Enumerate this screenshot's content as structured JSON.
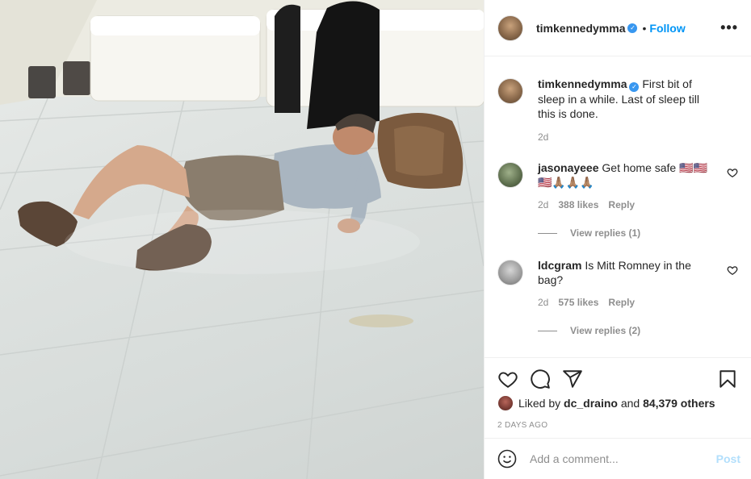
{
  "header": {
    "username": "timkennedymma",
    "separator": "•",
    "follow_label": "Follow",
    "more_label": "•••"
  },
  "caption": {
    "username": "timkennedymma",
    "text": "First bit of sleep in a while. Last of sleep till this is done.",
    "time": "2d"
  },
  "comments": [
    {
      "username": "jasonayeee",
      "text": "Get home safe 🇺🇸🇺🇸🇺🇸🙏🏽🙏🏽🙏🏽",
      "time": "2d",
      "likes": "388 likes",
      "reply_label": "Reply",
      "view_replies": "View replies (1)"
    },
    {
      "username": "ldcgram",
      "text": "Is Mitt Romney in the bag?",
      "time": "2d",
      "likes": "575 likes",
      "reply_label": "Reply",
      "view_replies": "View replies (2)"
    }
  ],
  "likes": {
    "prefix": "Liked by",
    "first_liker": "dc_draino",
    "middle": "and",
    "others": "84,379 others"
  },
  "posted_ago": "2 DAYS AGO",
  "add_comment": {
    "placeholder": "Add a comment...",
    "post_label": "Post"
  },
  "colors": {
    "accent": "#0095f6",
    "verified": "#3897f0",
    "muted": "#8e8e8e",
    "post_disabled": "#b2dffc"
  },
  "icons": [
    "verified-badge-icon",
    "more-options-icon",
    "heart-icon",
    "comment-icon",
    "share-icon",
    "bookmark-icon",
    "emoji-icon"
  ]
}
